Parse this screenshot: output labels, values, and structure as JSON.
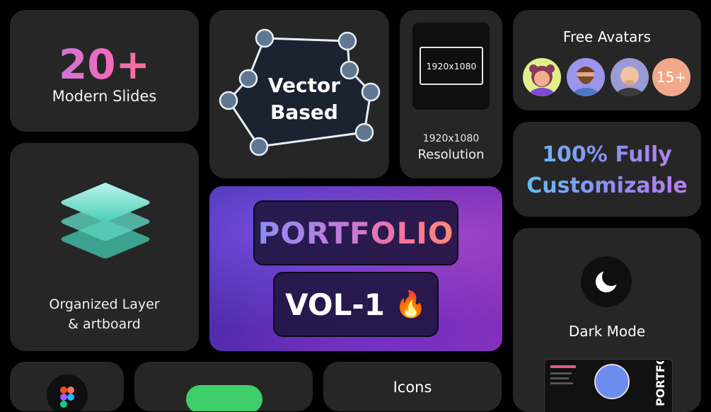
{
  "slides": {
    "count": "20+",
    "label": "Modern Slides"
  },
  "vector": {
    "line1": "Vector",
    "line2": "Based"
  },
  "resolution": {
    "screen": "1920x1080",
    "value": "1920x1080",
    "label": "Resolution"
  },
  "avatars": {
    "title": "Free Avatars",
    "more": "15+"
  },
  "customizable": {
    "line1": "100% Fully",
    "line2": "Customizable"
  },
  "layers": {
    "line1": "Organized Layer",
    "line2": "& artboard"
  },
  "portfolio": {
    "title": "PORTFOLIO",
    "vol": "VOL-1",
    "emoji": "🔥"
  },
  "dark_mode": {
    "label": "Dark Mode",
    "preview_side": "PORTFOLIO"
  },
  "bottom": {
    "icons_label": "Icons"
  },
  "icons": [
    "layers-stack-icon",
    "moon-icon",
    "figma-icon",
    "fire-icon"
  ],
  "colors": {
    "background": "#000000",
    "card": "#262626",
    "accent_green": "#3fcf6a",
    "avatar_badge": "#f0a98a"
  }
}
